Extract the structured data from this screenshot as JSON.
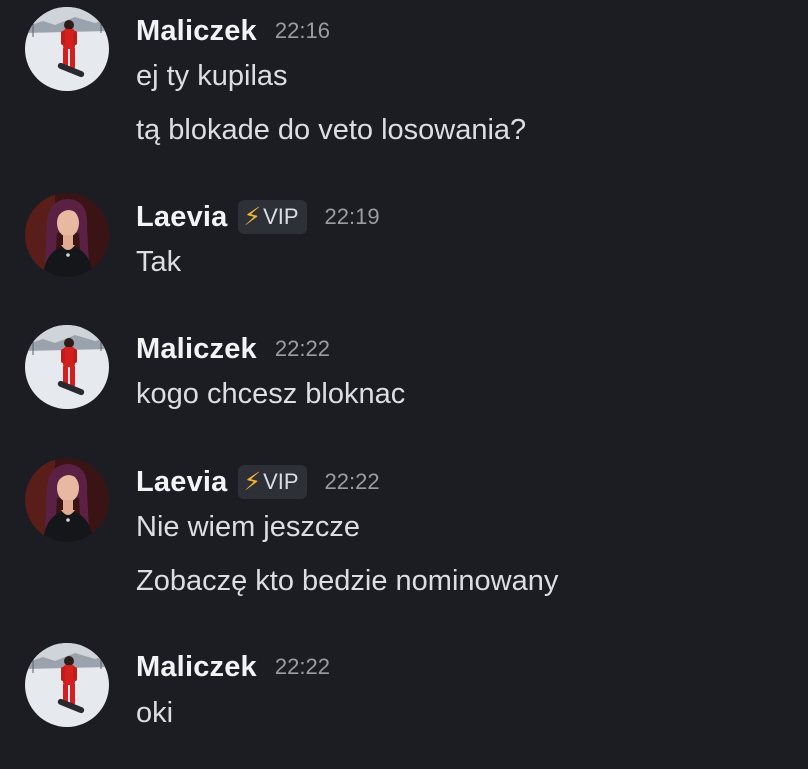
{
  "messages": [
    {
      "author": "Maliczek",
      "avatar": "snowboarder-avatar",
      "time": "22:16",
      "badge": null,
      "lines": [
        "ej ty kupilas",
        "tą blokade do veto losowania?"
      ]
    },
    {
      "author": "Laevia",
      "avatar": "woman-portrait-avatar",
      "time": "22:19",
      "badge": {
        "icon": "lightning-icon",
        "label": "VIP"
      },
      "lines": [
        "Tak"
      ]
    },
    {
      "author": "Maliczek",
      "avatar": "snowboarder-avatar",
      "time": "22:22",
      "badge": null,
      "lines": [
        "kogo chcesz bloknac"
      ]
    },
    {
      "author": "Laevia",
      "avatar": "woman-portrait-avatar",
      "time": "22:22",
      "badge": {
        "icon": "lightning-icon",
        "label": "VIP"
      },
      "lines": [
        "Nie wiem jeszcze",
        "Zobaczę kto bedzie nominowany"
      ]
    },
    {
      "author": "Maliczek",
      "avatar": "snowboarder-avatar",
      "time": "22:22",
      "badge": null,
      "lines": [
        "oki"
      ]
    }
  ],
  "colors": {
    "background": "#1c1d23",
    "author": "#f2f3f5",
    "message_text": "#dcdee2",
    "timestamp": "#9a9ca4",
    "badge_bg": "#2e3038",
    "badge_icon": "#f0b232"
  }
}
